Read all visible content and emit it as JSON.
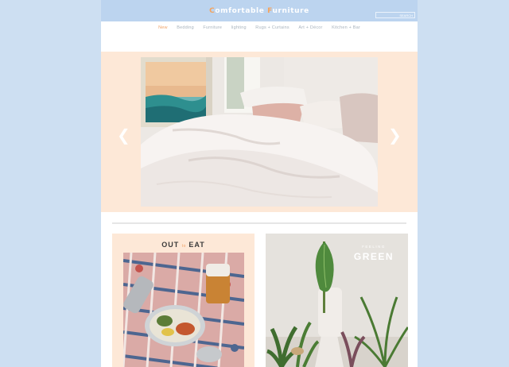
{
  "site": {
    "logo_part1_initial": "C",
    "logo_part1_rest": "omfortable ",
    "logo_part2_initial": "F",
    "logo_part2_rest": "urniture",
    "brand_accent": "#f5a35c",
    "header_color": "#bcd4ef",
    "background_color": "#cddff2"
  },
  "search": {
    "button_label": "SEARCH"
  },
  "nav": {
    "items": [
      {
        "label": "New",
        "active": true
      },
      {
        "label": "Bedding"
      },
      {
        "label": "Furniture"
      },
      {
        "label": "lighting"
      },
      {
        "label": "Rugs + Curtains"
      },
      {
        "label": "Art + Décor"
      },
      {
        "label": "Kitchen + Bar"
      }
    ]
  },
  "hero": {
    "prev_icon": "chevron-left-icon",
    "next_icon": "chevron-right-icon",
    "image": "bedroom-photo"
  },
  "promos": [
    {
      "title_part1": "OUT",
      "title_small": "to",
      "title_part2": "EAT",
      "image": "picnic-photo"
    },
    {
      "kicker": "FEELING",
      "title": "GREEN",
      "image": "plants-photo"
    }
  ]
}
